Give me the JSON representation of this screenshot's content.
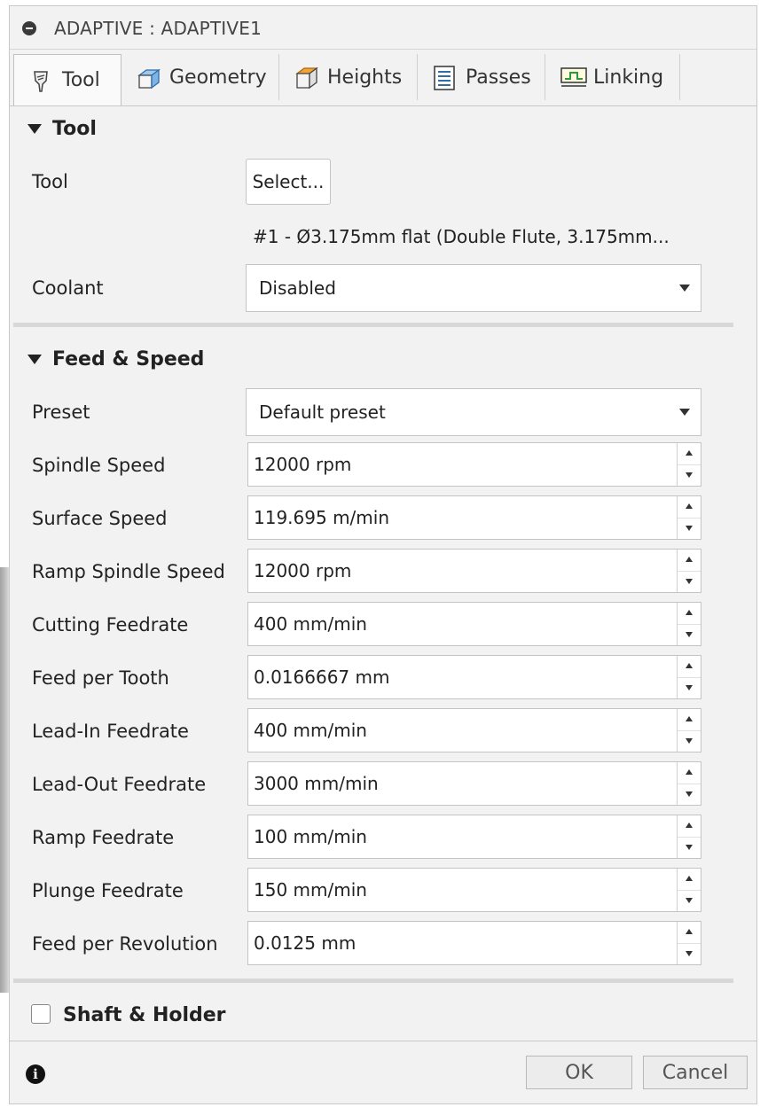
{
  "window": {
    "title": "ADAPTIVE : ADAPTIVE1"
  },
  "tabs": [
    {
      "label": "Tool",
      "icon": "tool-bit-icon",
      "active": true
    },
    {
      "label": "Geometry",
      "icon": "geometry-cube-icon"
    },
    {
      "label": "Heights",
      "icon": "heights-block-icon"
    },
    {
      "label": "Passes",
      "icon": "passes-list-icon"
    },
    {
      "label": "Linking",
      "icon": "linking-icon"
    }
  ],
  "tool_section": {
    "title": "Tool",
    "tool_label": "Tool",
    "select_button": "Select...",
    "tool_description": "#1 - Ø3.175mm flat (Double Flute, 3.175mm...",
    "coolant_label": "Coolant",
    "coolant_value": "Disabled"
  },
  "feed_section": {
    "title": "Feed & Speed",
    "preset_label": "Preset",
    "preset_value": "Default preset",
    "fields": [
      {
        "label": "Spindle Speed",
        "value": "12000 rpm"
      },
      {
        "label": "Surface Speed",
        "value": "119.695 m/min"
      },
      {
        "label": "Ramp Spindle Speed",
        "value": "12000 rpm"
      },
      {
        "label": "Cutting Feedrate",
        "value": "400 mm/min"
      },
      {
        "label": "Feed per Tooth",
        "value": "0.0166667 mm"
      },
      {
        "label": "Lead-In Feedrate",
        "value": "400 mm/min"
      },
      {
        "label": "Lead-Out Feedrate",
        "value": "3000 mm/min"
      },
      {
        "label": "Ramp Feedrate",
        "value": "100 mm/min"
      },
      {
        "label": "Plunge Feedrate",
        "value": "150 mm/min"
      },
      {
        "label": "Feed per Revolution",
        "value": "0.0125 mm"
      }
    ]
  },
  "shaft_section": {
    "title": "Shaft & Holder",
    "checked": false
  },
  "footer": {
    "ok_label": "OK",
    "cancel_label": "Cancel"
  }
}
